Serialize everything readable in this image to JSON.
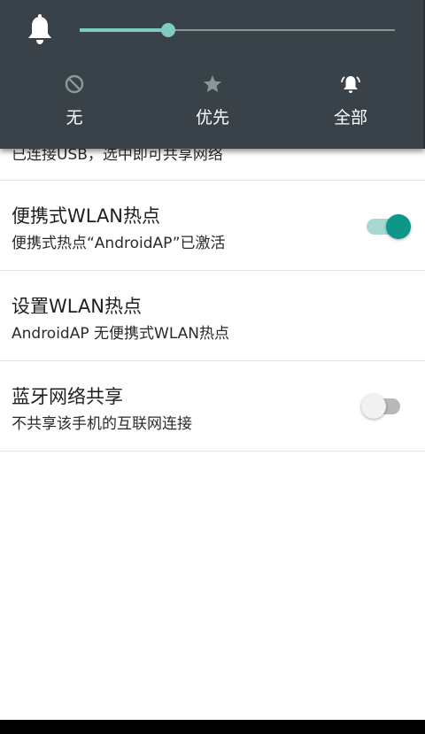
{
  "volume_panel": {
    "level": 0.28,
    "modes": [
      {
        "label": "无",
        "icon": "do-not-disturb-icon"
      },
      {
        "label": "优先",
        "icon": "star-icon"
      },
      {
        "label": "全部",
        "icon": "notification-bell-icon"
      }
    ],
    "selected_mode": "全部",
    "colors": {
      "background": "#384248",
      "accent": "#80cbc4"
    }
  },
  "settings": {
    "usb_tethering": {
      "summary": "已连接USB，选中即可共享网络"
    },
    "wlan_hotspot": {
      "title": "便携式WLAN热点",
      "summary": "便携式热点“AndroidAP”已激活",
      "enabled": true
    },
    "wlan_setup": {
      "title": "设置WLAN热点",
      "summary": "AndroidAP 无便携式WLAN热点"
    },
    "bluetooth_tethering": {
      "title": "蓝牙网络共享",
      "summary": "不共享该手机的互联网连接",
      "enabled": false
    },
    "colors": {
      "toggle_on": "#0f968a"
    }
  }
}
